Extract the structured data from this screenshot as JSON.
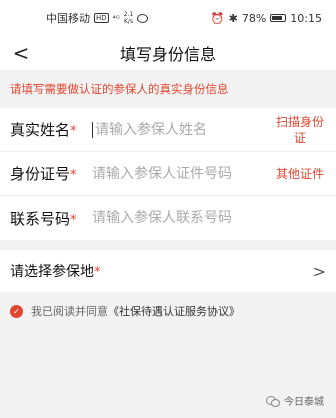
{
  "status_bar": {
    "carrier": "中国移动",
    "hd_badge": "HD",
    "signal": "⁴ᴳ",
    "speed": "2.1\nK/s",
    "battery_text": "78%",
    "time": "10:15"
  },
  "navbar": {
    "back_glyph": "<",
    "title": "填写身份信息"
  },
  "notice": "请填写需要做认证的参保人的真实身份信息",
  "form": {
    "rows": [
      {
        "label": "真实姓名",
        "placeholder": "请输入参保人姓名",
        "action": "扫描身份证"
      },
      {
        "label": "身份证号",
        "placeholder": "请输入参保人证件号码",
        "action": "其他证件"
      },
      {
        "label": "联系号码",
        "placeholder": "请输入参保人联系号码",
        "action": ""
      }
    ],
    "required_mark": "*"
  },
  "region": {
    "label": "请选择参保地",
    "chevron": ">"
  },
  "agreement": {
    "prefix": "我已阅读并同意",
    "link": "《社保待遇认证服务协议》"
  },
  "watermark": "今日泰城",
  "colors": {
    "accent": "#e0462f",
    "background": "#f2f2f2"
  }
}
